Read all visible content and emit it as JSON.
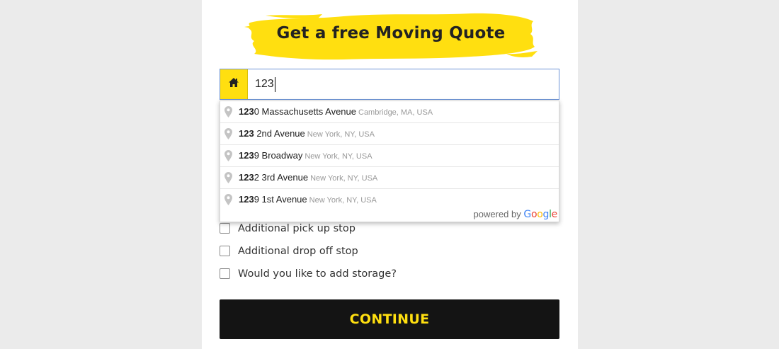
{
  "form": {
    "title": "Get a free Moving Quote",
    "address": {
      "value": "123",
      "icon": "home-icon"
    },
    "suggestions": [
      {
        "match": "123",
        "rest": "0 Massachusetts Avenue",
        "secondary": "Cambridge, MA, USA"
      },
      {
        "match": "123",
        "rest": " 2nd Avenue",
        "secondary": "New York, NY, USA"
      },
      {
        "match": "123",
        "rest": "9 Broadway",
        "secondary": "New York, NY, USA"
      },
      {
        "match": "123",
        "rest": "2 3rd Avenue",
        "secondary": "New York, NY, USA"
      },
      {
        "match": "123",
        "rest": "9 1st Avenue",
        "secondary": "New York, NY, USA"
      }
    ],
    "powered_by": "powered by",
    "google_logo": "Google",
    "checkboxes": [
      {
        "label": "Additional pick up stop",
        "checked": false
      },
      {
        "label": "Additional drop off stop",
        "checked": false
      },
      {
        "label": "Would you like to add storage?",
        "checked": false
      }
    ],
    "continue_label": "CONTINUE"
  },
  "colors": {
    "accent": "#ffdf10",
    "button_bg": "#141414",
    "page_bg": "#ebebeb",
    "input_border": "#6d93d6"
  }
}
